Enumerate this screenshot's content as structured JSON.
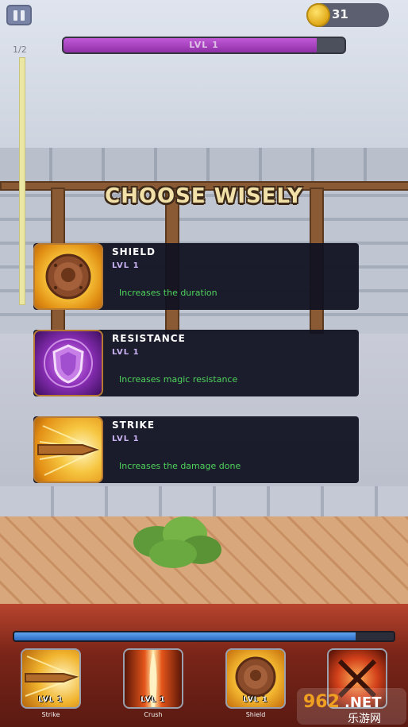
{
  "hud": {
    "coins": "31",
    "level_label": "LVL 1",
    "level_progress": 0.9,
    "wave_label": "1/2"
  },
  "title": "CHOOSE WISELY",
  "choices": [
    {
      "name": "SHIELD",
      "level": "LVL 1",
      "description": "Increases the duration",
      "icon": "shield-icon"
    },
    {
      "name": "RESISTANCE",
      "level": "LVL 1",
      "description": "Increases magic resistance",
      "icon": "magic-shield-icon"
    },
    {
      "name": "STRIKE",
      "level": "LVL 1",
      "description": "Increases the damage done",
      "icon": "sword-strike-icon"
    }
  ],
  "xp_progress": 0.9,
  "skills": [
    {
      "name": "Strike",
      "level": "LVL 1",
      "icon": "sword-strike-icon"
    },
    {
      "name": "Crush",
      "level": "LVL 1",
      "icon": "fire-pillar-icon"
    },
    {
      "name": "Shield",
      "level": "LVL 1",
      "icon": "shield-icon"
    },
    {
      "name": "",
      "level": "",
      "icon": "crossed-swords-fire-icon"
    }
  ],
  "watermark": {
    "brand": "962.NET",
    "sub": "乐游网"
  }
}
